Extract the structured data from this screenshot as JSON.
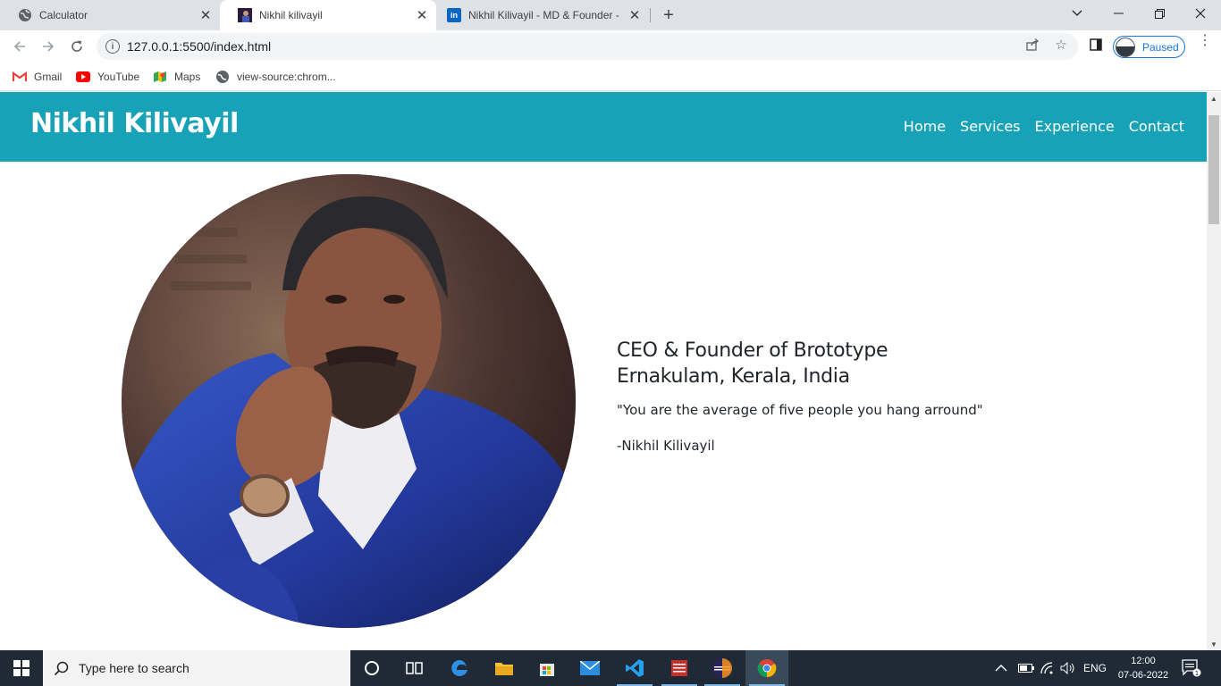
{
  "browser": {
    "tabs": [
      {
        "title": "Calculator",
        "active": false
      },
      {
        "title": "Nikhil kilivayil",
        "active": true
      },
      {
        "title": "Nikhil Kilivayil - MD & Founder -",
        "active": false
      }
    ],
    "url": "127.0.0.1:5500/index.html",
    "profile_status": "Paused",
    "bookmarks": [
      "Gmail",
      "YouTube",
      "Maps",
      "view-source:chrom..."
    ]
  },
  "site": {
    "brand": "Nikhil Kilivayil",
    "nav": [
      "Home",
      "Services",
      "Experience",
      "Contact"
    ],
    "headline_line1": "CEO & Founder of Brototype",
    "headline_line2": "Ernakulam, Kerala, India",
    "quote": "\"You are the average of five people you hang arround\"",
    "signature": "-Nikhil Kilivayil"
  },
  "taskbar": {
    "search_placeholder": "Type here to search",
    "language": "ENG",
    "time": "12:00",
    "date": "07-06-2022",
    "notification_count": "1"
  },
  "colors": {
    "header": "#17a2b8",
    "taskbar": "#1f2a36"
  }
}
